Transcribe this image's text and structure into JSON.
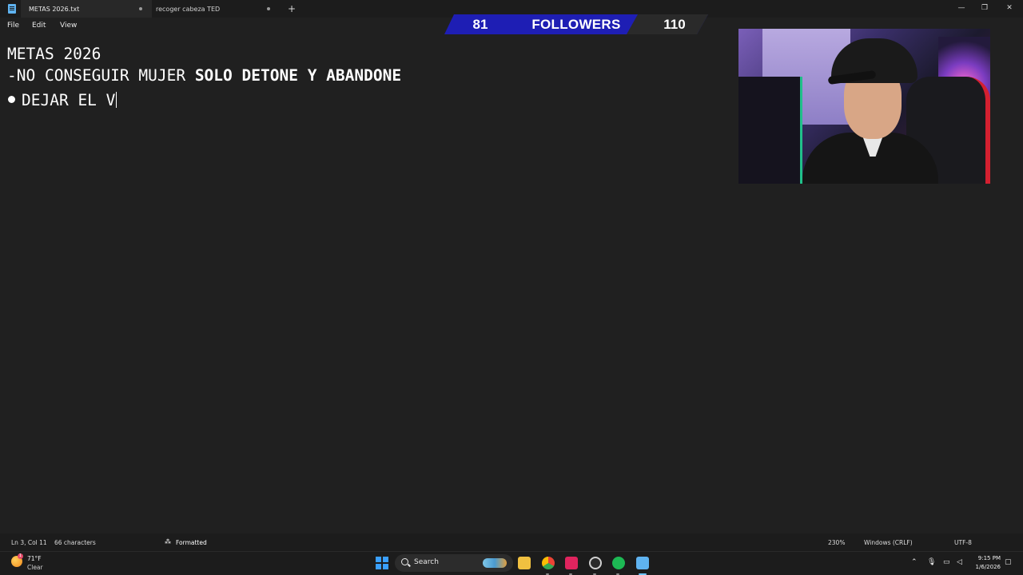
{
  "window": {
    "tabs": [
      {
        "label": "METAS 2026.txt",
        "active": true
      },
      {
        "label": "recoger cabeza TED",
        "active": false
      }
    ],
    "new_tab": "+",
    "minimize": "—",
    "maximize": "❐",
    "close": "✕"
  },
  "menu": {
    "items": [
      "File",
      "Edit",
      "View"
    ]
  },
  "followers_overlay": {
    "current": "81",
    "label": "FOLLOWERS",
    "goal": "110",
    "colors": {
      "bar": "#1e1eb4",
      "end": "#2a2a2a"
    }
  },
  "document": {
    "line1": "METAS 2026",
    "line2_normal": "-NO CONSEGUIR MUJER ",
    "line2_bold": "SOLO DETONE Y ABANDONE",
    "line3": "DEJAR EL V"
  },
  "statusbar": {
    "position": "Ln 3, Col 11",
    "characters": "66 characters",
    "formatted": "Formatted",
    "zoom": "230%",
    "line_endings": "Windows (CRLF)",
    "encoding": "UTF-8"
  },
  "taskbar": {
    "weather_temp": "71°F",
    "weather_condition": "Clear",
    "weather_badge": "1",
    "search_label": "Search",
    "apps": [
      "windows-start-icon",
      "file-explorer-icon",
      "chrome-icon",
      "tiktok-icon",
      "obs-icon",
      "spotify-icon",
      "notepad-icon"
    ],
    "time": "9:15 PM",
    "date": "1/6/2026"
  },
  "colors": {
    "editor_bg": "#202020",
    "text": "#ffffff",
    "accent": "#3aa0ff"
  }
}
